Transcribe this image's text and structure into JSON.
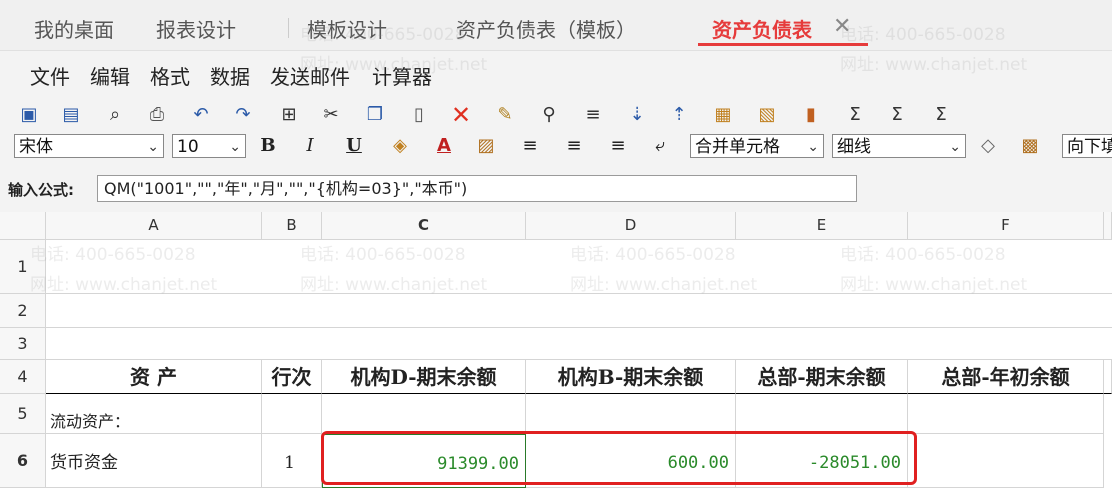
{
  "tabs": [
    {
      "label": "我的桌面"
    },
    {
      "label": "报表设计"
    },
    {
      "label": "模板设计"
    },
    {
      "label": "资产负债表（模板）"
    },
    {
      "label": "资产负债表"
    }
  ],
  "menu": [
    "文件",
    "编辑",
    "格式",
    "数据",
    "发送邮件",
    "计算器"
  ],
  "toolbar": {
    "font": "宋体",
    "size": "10",
    "merge": "合并单元格",
    "line": "细线",
    "fill": "向下填"
  },
  "formula": {
    "label": "输入公式:",
    "value": "QM(\"1001\",\"\",\"年\",\"月\",\"\",\"{机构=03}\",\"本币\")"
  },
  "columns": [
    "A",
    "B",
    "C",
    "D",
    "E",
    "F"
  ],
  "rows": [
    "1",
    "2",
    "3",
    "4",
    "5",
    "6"
  ],
  "sheet": {
    "row4": [
      "资        产",
      "行次",
      "机构D-期末余额",
      "机构B-期末余额",
      "总部-期末余额",
      "总部-年初余额"
    ],
    "row5": [
      "流动资产："
    ],
    "row6": {
      "item": "货币资金",
      "line": "1",
      "c": "91399.00",
      "d": "600.00",
      "e": "-28051.00"
    }
  },
  "watermark": {
    "phone": "电话: 400-665-0028",
    "site": "网址: www.chanjet.net"
  }
}
